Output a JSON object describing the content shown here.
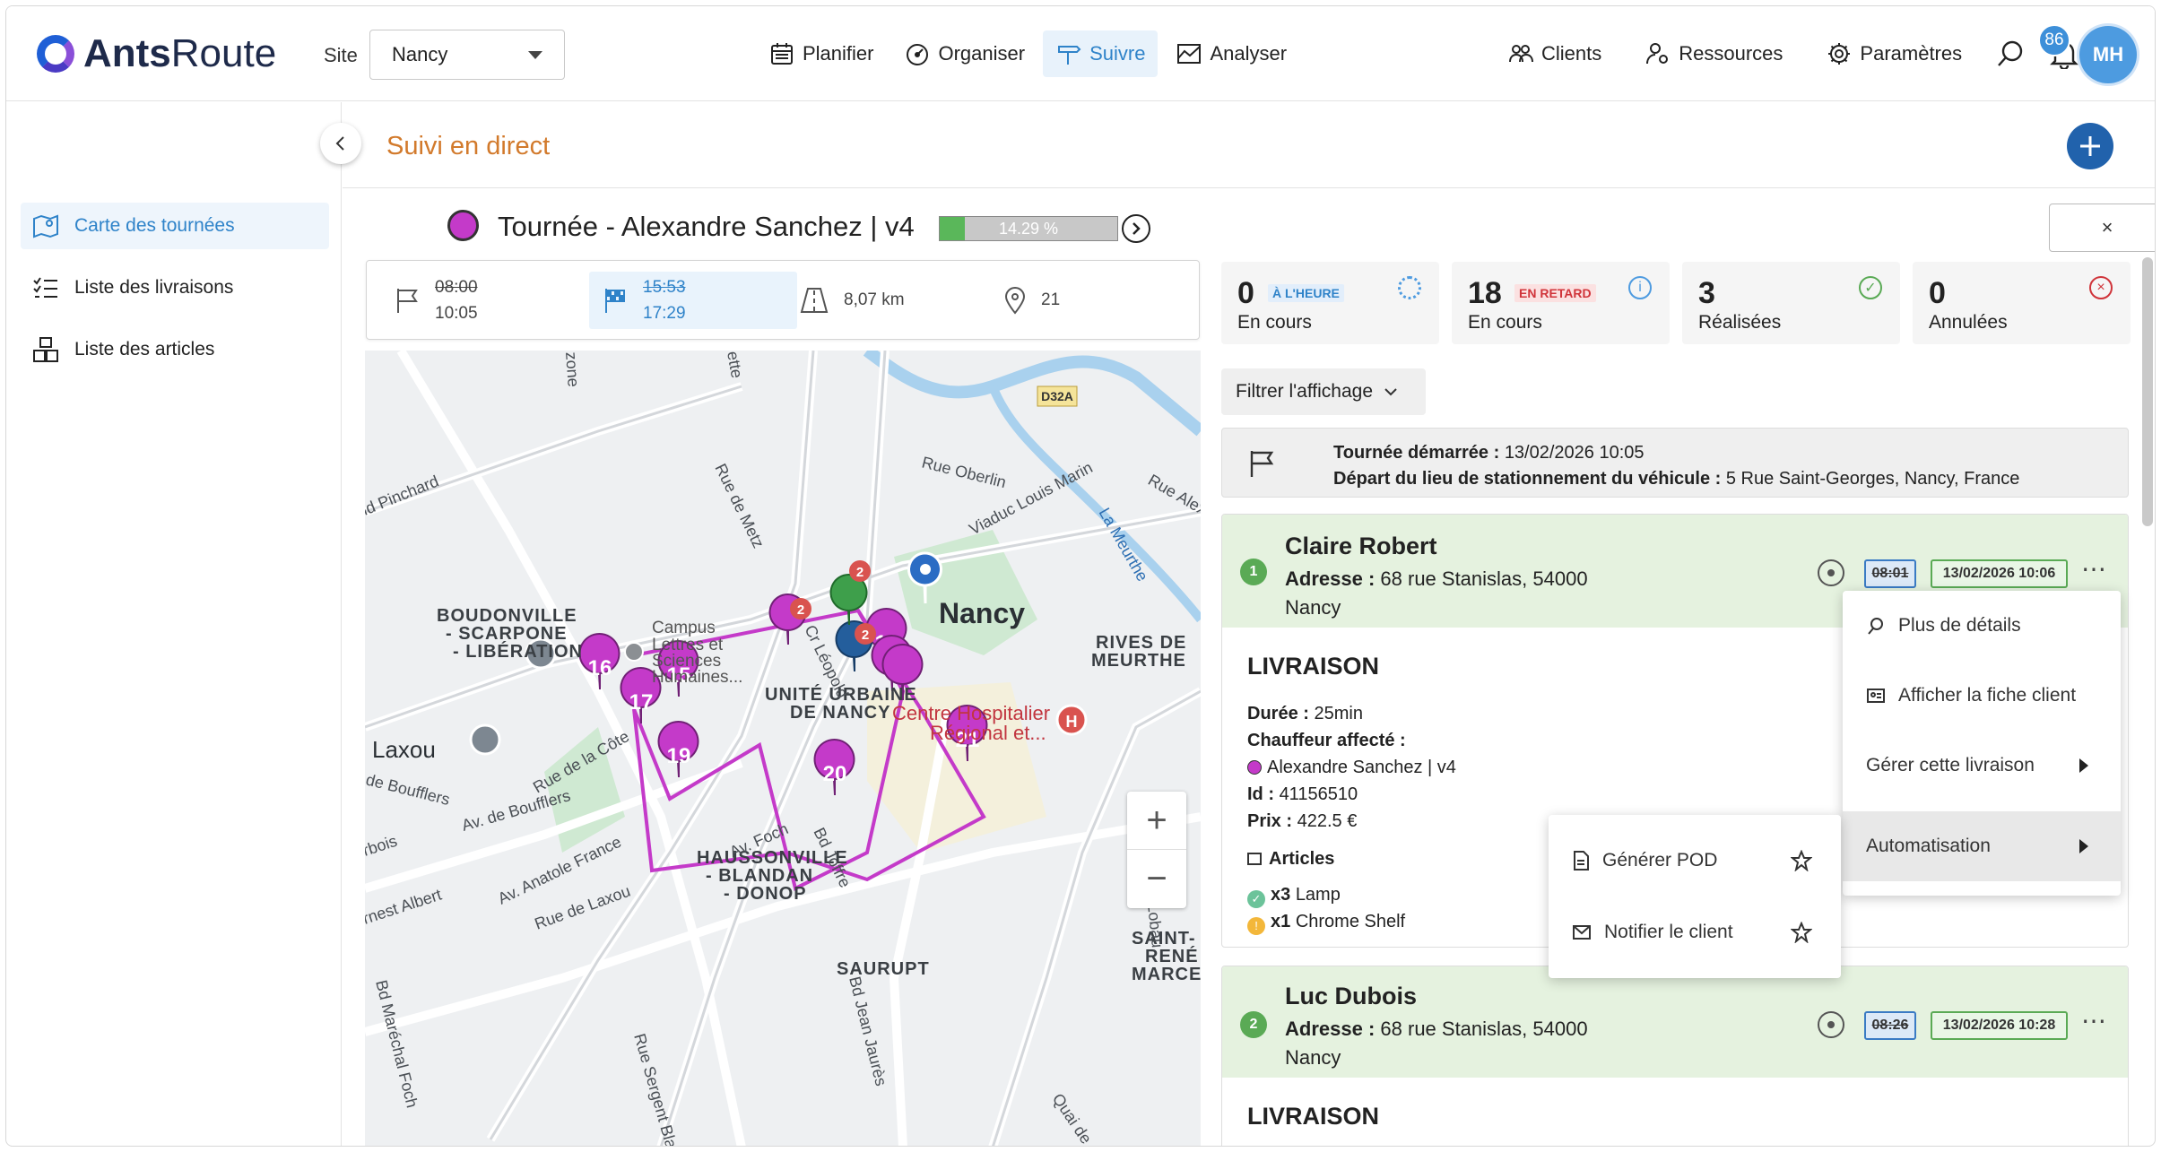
{
  "app": {
    "brand_prefix": "Ants",
    "brand_suffix": "Route"
  },
  "site": {
    "label": "Site",
    "value": "Nancy"
  },
  "nav": [
    {
      "label": "Planifier",
      "icon": "calendar-icon"
    },
    {
      "label": "Organiser",
      "icon": "gauge-icon"
    },
    {
      "label": "Suivre",
      "icon": "signpost-icon",
      "active": true
    },
    {
      "label": "Analyser",
      "icon": "chart-line-icon"
    }
  ],
  "nav_right": [
    {
      "label": "Clients",
      "icon": "users-icon"
    },
    {
      "label": "Ressources",
      "icon": "user-gear-icon"
    },
    {
      "label": "Paramètres",
      "icon": "gear-icon"
    }
  ],
  "notifications": {
    "count": "86"
  },
  "user": {
    "initials": "MH"
  },
  "sidebar": {
    "items": [
      {
        "label": "Carte des tournées",
        "icon": "map-pin-icon",
        "active": true
      },
      {
        "label": "Liste des livraisons",
        "icon": "checklist-icon"
      },
      {
        "label": "Liste des articles",
        "icon": "boxes-icon"
      }
    ]
  },
  "page": {
    "title": "Suivi en direct"
  },
  "tour": {
    "title": "Tournée - Alexandre Sanchez | v4",
    "color": "#c43ac9",
    "progress_percent": 14.29,
    "progress_label": "14.29 %",
    "close_label": "×"
  },
  "summary": {
    "start_planned": "08:00",
    "start_actual": "10:05",
    "end_planned": "15:53",
    "end_actual": "17:29",
    "distance": "8,07 km",
    "stops": "21"
  },
  "kpis": [
    {
      "value": "0",
      "tag": "À L'HEURE",
      "label": "En cours",
      "icon": "spinner-icon"
    },
    {
      "value": "18",
      "tag": "EN RETARD",
      "label": "En cours",
      "icon": "info-icon"
    },
    {
      "value": "3",
      "tag": "",
      "label": "Réalisées",
      "icon": "check-circle-icon"
    },
    {
      "value": "0",
      "tag": "",
      "label": "Annulées",
      "icon": "x-circle-icon"
    }
  ],
  "filter": {
    "label": "Filtrer l'affichage"
  },
  "tour_start": {
    "started_label": "Tournée démarrée :",
    "started_value": "13/02/2026 10:05",
    "depart_label": "Départ du lieu de stationnement du véhicule :",
    "depart_value": "5 Rue Saint-Georges, Nancy, France"
  },
  "deliveries": [
    {
      "index": "1",
      "name": "Claire Robert",
      "address_label": "Adresse :",
      "address_line1": "68 rue Stanislas, 54000",
      "address_line2": "Nancy",
      "planned_time": "08:01",
      "actual_time": "13/02/2026 10:06",
      "type": "LIVRAISON",
      "duration_label": "Durée :",
      "duration": "25min",
      "driver_label": "Chauffeur affecté :",
      "driver": "Alexandre Sanchez | v4",
      "id_label": "Id :",
      "id": "41156510",
      "price_label": "Prix :",
      "price": "422.5 €",
      "articles_label": "Articles",
      "articles": [
        {
          "qty": "x3",
          "name": "Lamp",
          "status": "done"
        },
        {
          "qty": "x1",
          "name": "Chrome Shelf",
          "status": "pending"
        }
      ]
    },
    {
      "index": "2",
      "name": "Luc Dubois",
      "address_label": "Adresse :",
      "address_line1": "68 rue Stanislas, 54000",
      "address_line2": "Nancy",
      "planned_time": "08:26",
      "actual_time": "13/02/2026 10:28",
      "type": "LIVRAISON"
    }
  ],
  "context_menu": {
    "items": [
      {
        "label": "Plus de détails",
        "icon": "search-doc-icon"
      },
      {
        "label": "Afficher la fiche client",
        "icon": "id-card-icon"
      },
      {
        "label": "Gérer cette livraison",
        "has_submenu": true
      },
      {
        "label": "Automatisation",
        "has_submenu": true,
        "highlighted": true
      }
    ]
  },
  "submenu": {
    "items": [
      {
        "label": "Générer POD",
        "icon": "document-icon"
      },
      {
        "label": "Notifier le client",
        "icon": "mail-icon"
      }
    ]
  },
  "map": {
    "labels": {
      "boudonville": "BOUDONVILLE\n- SCARPONE\n- LIBÉRATION",
      "campus": "Campus Lettres et Sciences Humaines...",
      "ville_urbaine": "UNITÉ URBAINE\nDE NANCY",
      "nancy": "Nancy",
      "rives": "RIVES DE\nMEURTHE",
      "laxou": "Laxou",
      "haussonville": "HAUSSONVILLE\n- BLANDAN\n- DONOP",
      "saurupt": "SAURUPT",
      "saint_renemarce": "SAINT-\nRENÉ\nMARCE",
      "centre_hosp": "Centre Hospitalier Régional et...",
      "d32a": "D32A",
      "rue_oberlin": "Rue Oberlin",
      "viaduc": "Viaduc Louis Marin",
      "meurthe": "La Meurthe",
      "bouffiers": "de Boufflers",
      "av_foch": "Av. Foch",
      "bd_joffre": "Bd Joffre",
      "rue_cote": "Rue de la Côte",
      "av_anatole": "Av. Anatole France",
      "rue_laxou": "Rue de Laxou",
      "bd_jean_jaures": "Bd Jean Jaurès",
      "cr_leopold": "Cr Léopold",
      "rue_metz": "Rue de Metz",
      "pinchard": "id Pinchard",
      "ernest_albert": "rnest Albert",
      "rue_alex": "Rue Alex",
      "bd_lobau": "Bd Lobau",
      "bd_marechal_foch": "Bd Maréchal Foch",
      "rue_sergent": "Rue Sergent Blandan",
      "quai": "Quai de",
      "zone": "zone",
      "rbois": "rbois",
      "ette": "ette"
    },
    "markers": [
      "16",
      "15",
      "17",
      "19",
      "20",
      "21",
      "12",
      "2",
      "2"
    ]
  }
}
